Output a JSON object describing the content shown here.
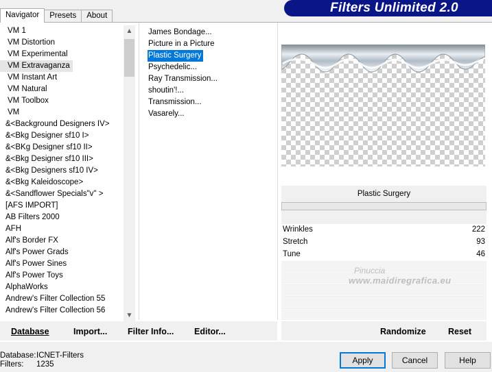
{
  "tabs": [
    {
      "label": "Navigator",
      "active": true
    },
    {
      "label": "Presets",
      "active": false
    },
    {
      "label": "About",
      "active": false
    }
  ],
  "banner_title": "Filters Unlimited 2.0",
  "categories": [
    "VM 1",
    "VM Distortion",
    "VM Experimental",
    "VM Extravaganza",
    "VM Instant Art",
    "VM Natural",
    "VM Toolbox",
    "VM",
    "&<Background Designers IV>",
    "&<Bkg Designer sf10 I>",
    "&<BKg Designer sf10 II>",
    "&<Bkg Designer sf10 III>",
    "&<Bkg Designers sf10 IV>",
    "&<Bkg Kaleidoscope>",
    "&<Sandflower Specials\"v\" >",
    "[AFS IMPORT]",
    "AB Filters 2000",
    "AFH",
    "Alf's Border FX",
    "Alf's Power Grads",
    "Alf's Power Sines",
    "Alf's Power Toys",
    "AlphaWorks",
    "Andrew's Filter Collection 55",
    "Andrew's Filter Collection 56"
  ],
  "selected_category": "VM Extravaganza",
  "filters": [
    "James Bondage...",
    "Picture in a Picture",
    "Plastic Surgery",
    "Psychedelic...",
    "Ray Transmission...",
    "shoutin'!...",
    "Transmission...",
    "Vasarely..."
  ],
  "selected_filter": "Plastic Surgery",
  "filter_name": "Plastic Surgery",
  "params": [
    {
      "label": "Wrinkles",
      "value": "222"
    },
    {
      "label": "Stretch",
      "value": "93"
    },
    {
      "label": "Tune",
      "value": "46"
    }
  ],
  "watermark": {
    "line1": "Pinuccia",
    "line2": "www.maidiregrafica.eu"
  },
  "buttons_left": {
    "database": "Database",
    "import": "Import...",
    "filter_info": "Filter Info...",
    "editor": "Editor..."
  },
  "buttons_right": {
    "randomize": "Randomize",
    "reset": "Reset"
  },
  "status": {
    "database_label": "Database:",
    "database_value": "ICNET-Filters",
    "filters_label": "Filters:",
    "filters_value": "1235"
  },
  "dialog_buttons": {
    "apply": "Apply",
    "cancel": "Cancel",
    "help": "Help"
  },
  "colors": {
    "banner": "#0a1688",
    "selection": "#0078d7"
  }
}
